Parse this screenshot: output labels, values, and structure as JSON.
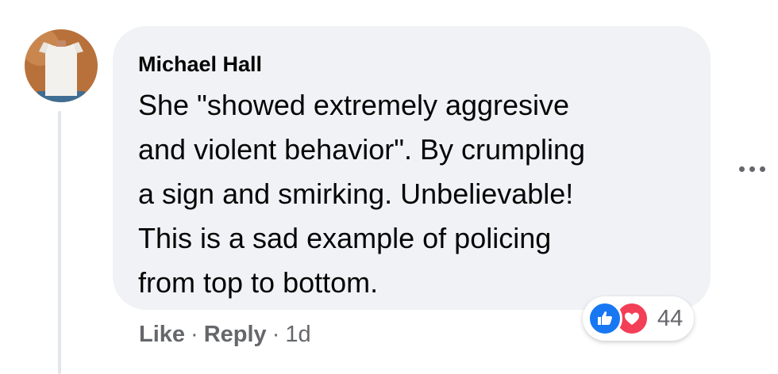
{
  "comment": {
    "author": "Michael Hall",
    "text": "She \"showed extremely aggresive\nand violent behavior\". By crumpling\na sign and smirking. Unbelievable!\nThis is a sad example of policing\nfrom top to bottom.",
    "reactions": {
      "count": "44",
      "icons": [
        "like-icon",
        "love-icon"
      ]
    },
    "actions": {
      "like_label": "Like",
      "reply_label": "Reply",
      "separator": "·",
      "timestamp": "1d"
    }
  },
  "colors": {
    "bubble": "#f0f2f5",
    "text": "#050505",
    "secondary_text": "#65676b",
    "like": "#1877f2",
    "love": "#f33e58",
    "thread_line": "#e4e6eb"
  }
}
